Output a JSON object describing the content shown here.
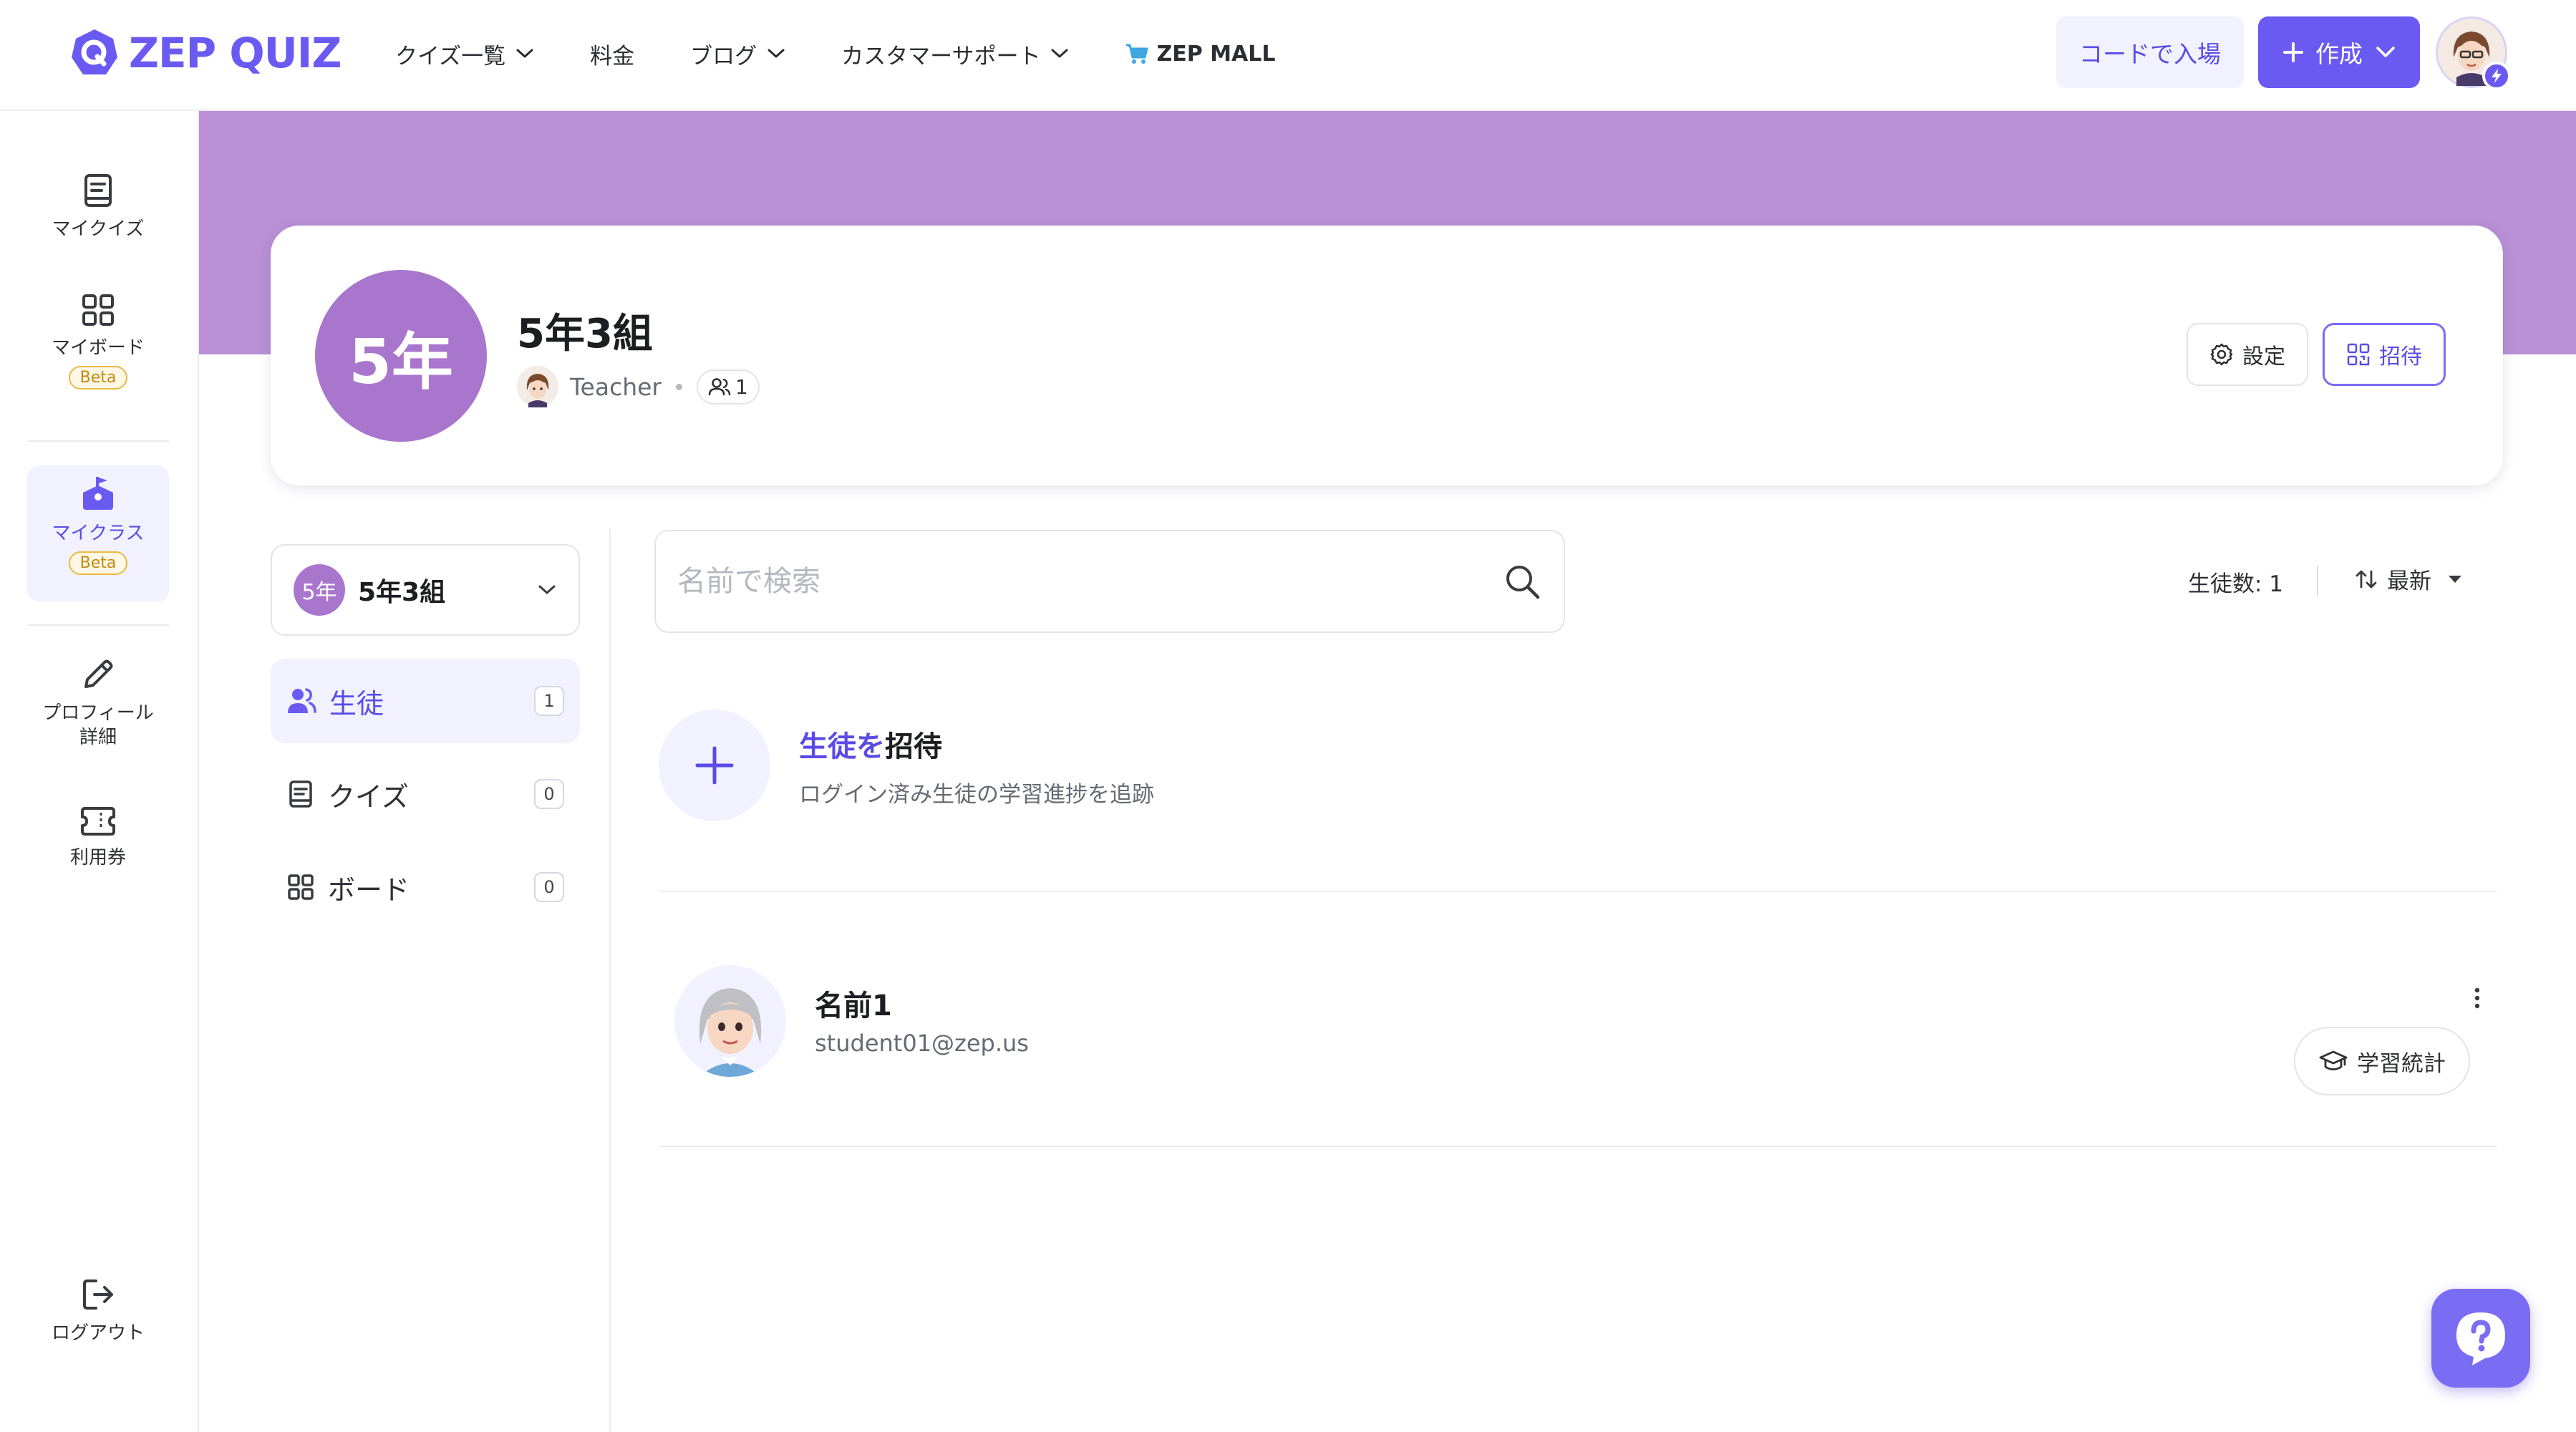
{
  "header": {
    "logo_text": "ZEP QUIZ",
    "nav": {
      "quiz_list": "クイズ一覧",
      "pricing": "料金",
      "blog": "ブログ",
      "support": "カスタマーサポート",
      "mall": "ZEP MALL"
    },
    "code_entry_label": "コードで入場",
    "create_label": "作成"
  },
  "sidebar": {
    "my_quiz": "マイクイズ",
    "my_board": "マイボード",
    "my_class": "マイクラス",
    "beta": "Beta",
    "profile_line1": "プロフィール",
    "profile_line2": "詳細",
    "tickets": "利用券",
    "logout": "ログアウト"
  },
  "class": {
    "badge": "5年",
    "title": "5年3組",
    "teacher": "Teacher",
    "member_count": "1",
    "settings_label": "設定",
    "invite_label": "招待"
  },
  "panel": {
    "selector_badge": "5年",
    "selector_name": "5年3組",
    "items": [
      {
        "label": "生徒",
        "count": "1"
      },
      {
        "label": "クイズ",
        "count": "0"
      },
      {
        "label": "ボード",
        "count": "0"
      }
    ]
  },
  "content": {
    "search_placeholder": "名前で検索",
    "student_count": "生徒数: 1",
    "sort_label": "最新",
    "invite_title_accent": "生徒を",
    "invite_title_rest": "招待",
    "invite_sub": "ログイン済み生徒の学習進捗を追跡",
    "students": [
      {
        "name": "名前1",
        "email": "student01@zep.us",
        "stats_label": "学習統計"
      }
    ]
  },
  "colors": {
    "accent": "#6a5af2",
    "banner": "#b990d6",
    "class_badge": "#a976cd"
  }
}
